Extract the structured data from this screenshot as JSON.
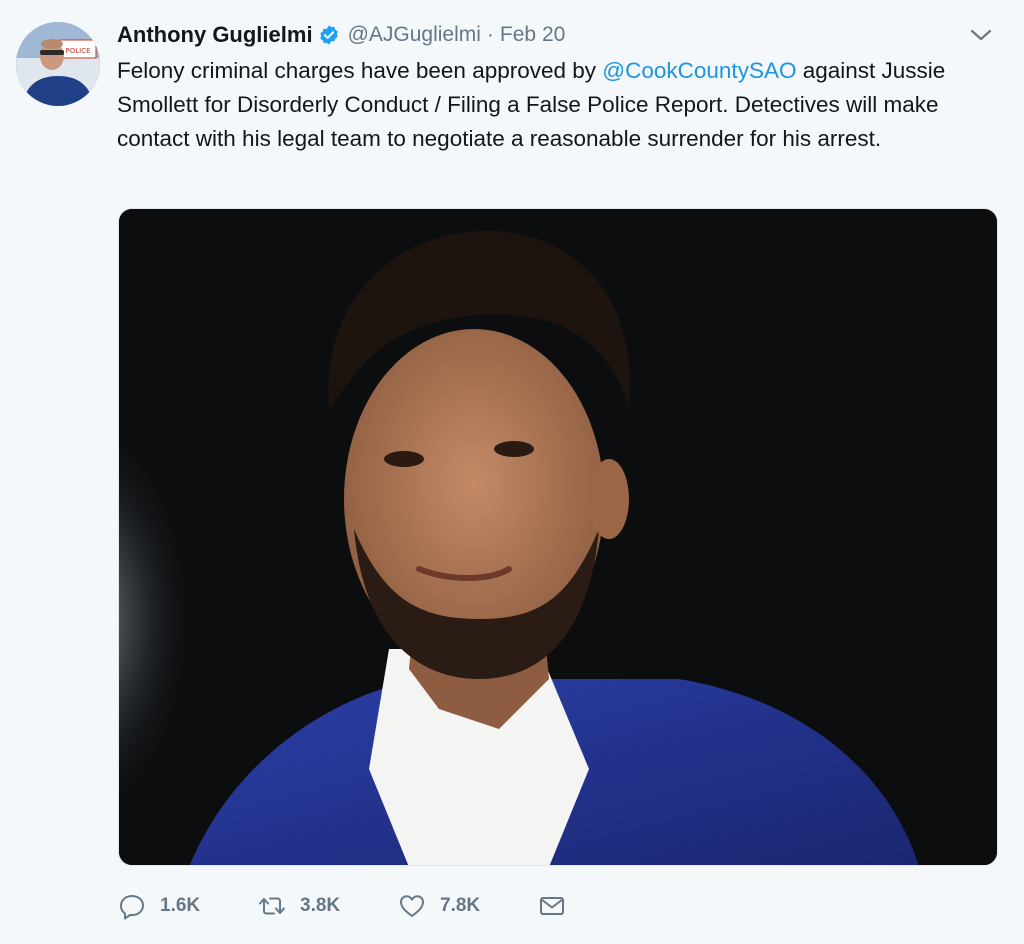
{
  "tweet": {
    "author": {
      "display_name": "Anthony Guglielmi",
      "handle": "@AJGuglielmi",
      "verified": true,
      "avatar_patch_text": "POLICE"
    },
    "separator": "·",
    "date": "Feb 20",
    "text": {
      "part1": "Felony criminal charges have been approved by ",
      "mention": "@CookCountySAO",
      "part2": " against Jussie Smollett for Disorderly Conduct / Filing a False Police Report. Detectives will make contact with his legal team to negotiate a reasonable surrender for his arrest."
    },
    "media": {
      "kind": "photo"
    },
    "actions": {
      "reply": {
        "icon": "reply-icon",
        "count": "1.6K"
      },
      "retweet": {
        "icon": "retweet-icon",
        "count": "3.8K"
      },
      "like": {
        "icon": "heart-icon",
        "count": "7.8K"
      },
      "dm": {
        "icon": "envelope-icon"
      }
    }
  },
  "colors": {
    "background": "#f5f8fa",
    "text": "#14171a",
    "secondary": "#657786",
    "link": "#1b95e0",
    "verified": "#1da1f2"
  }
}
